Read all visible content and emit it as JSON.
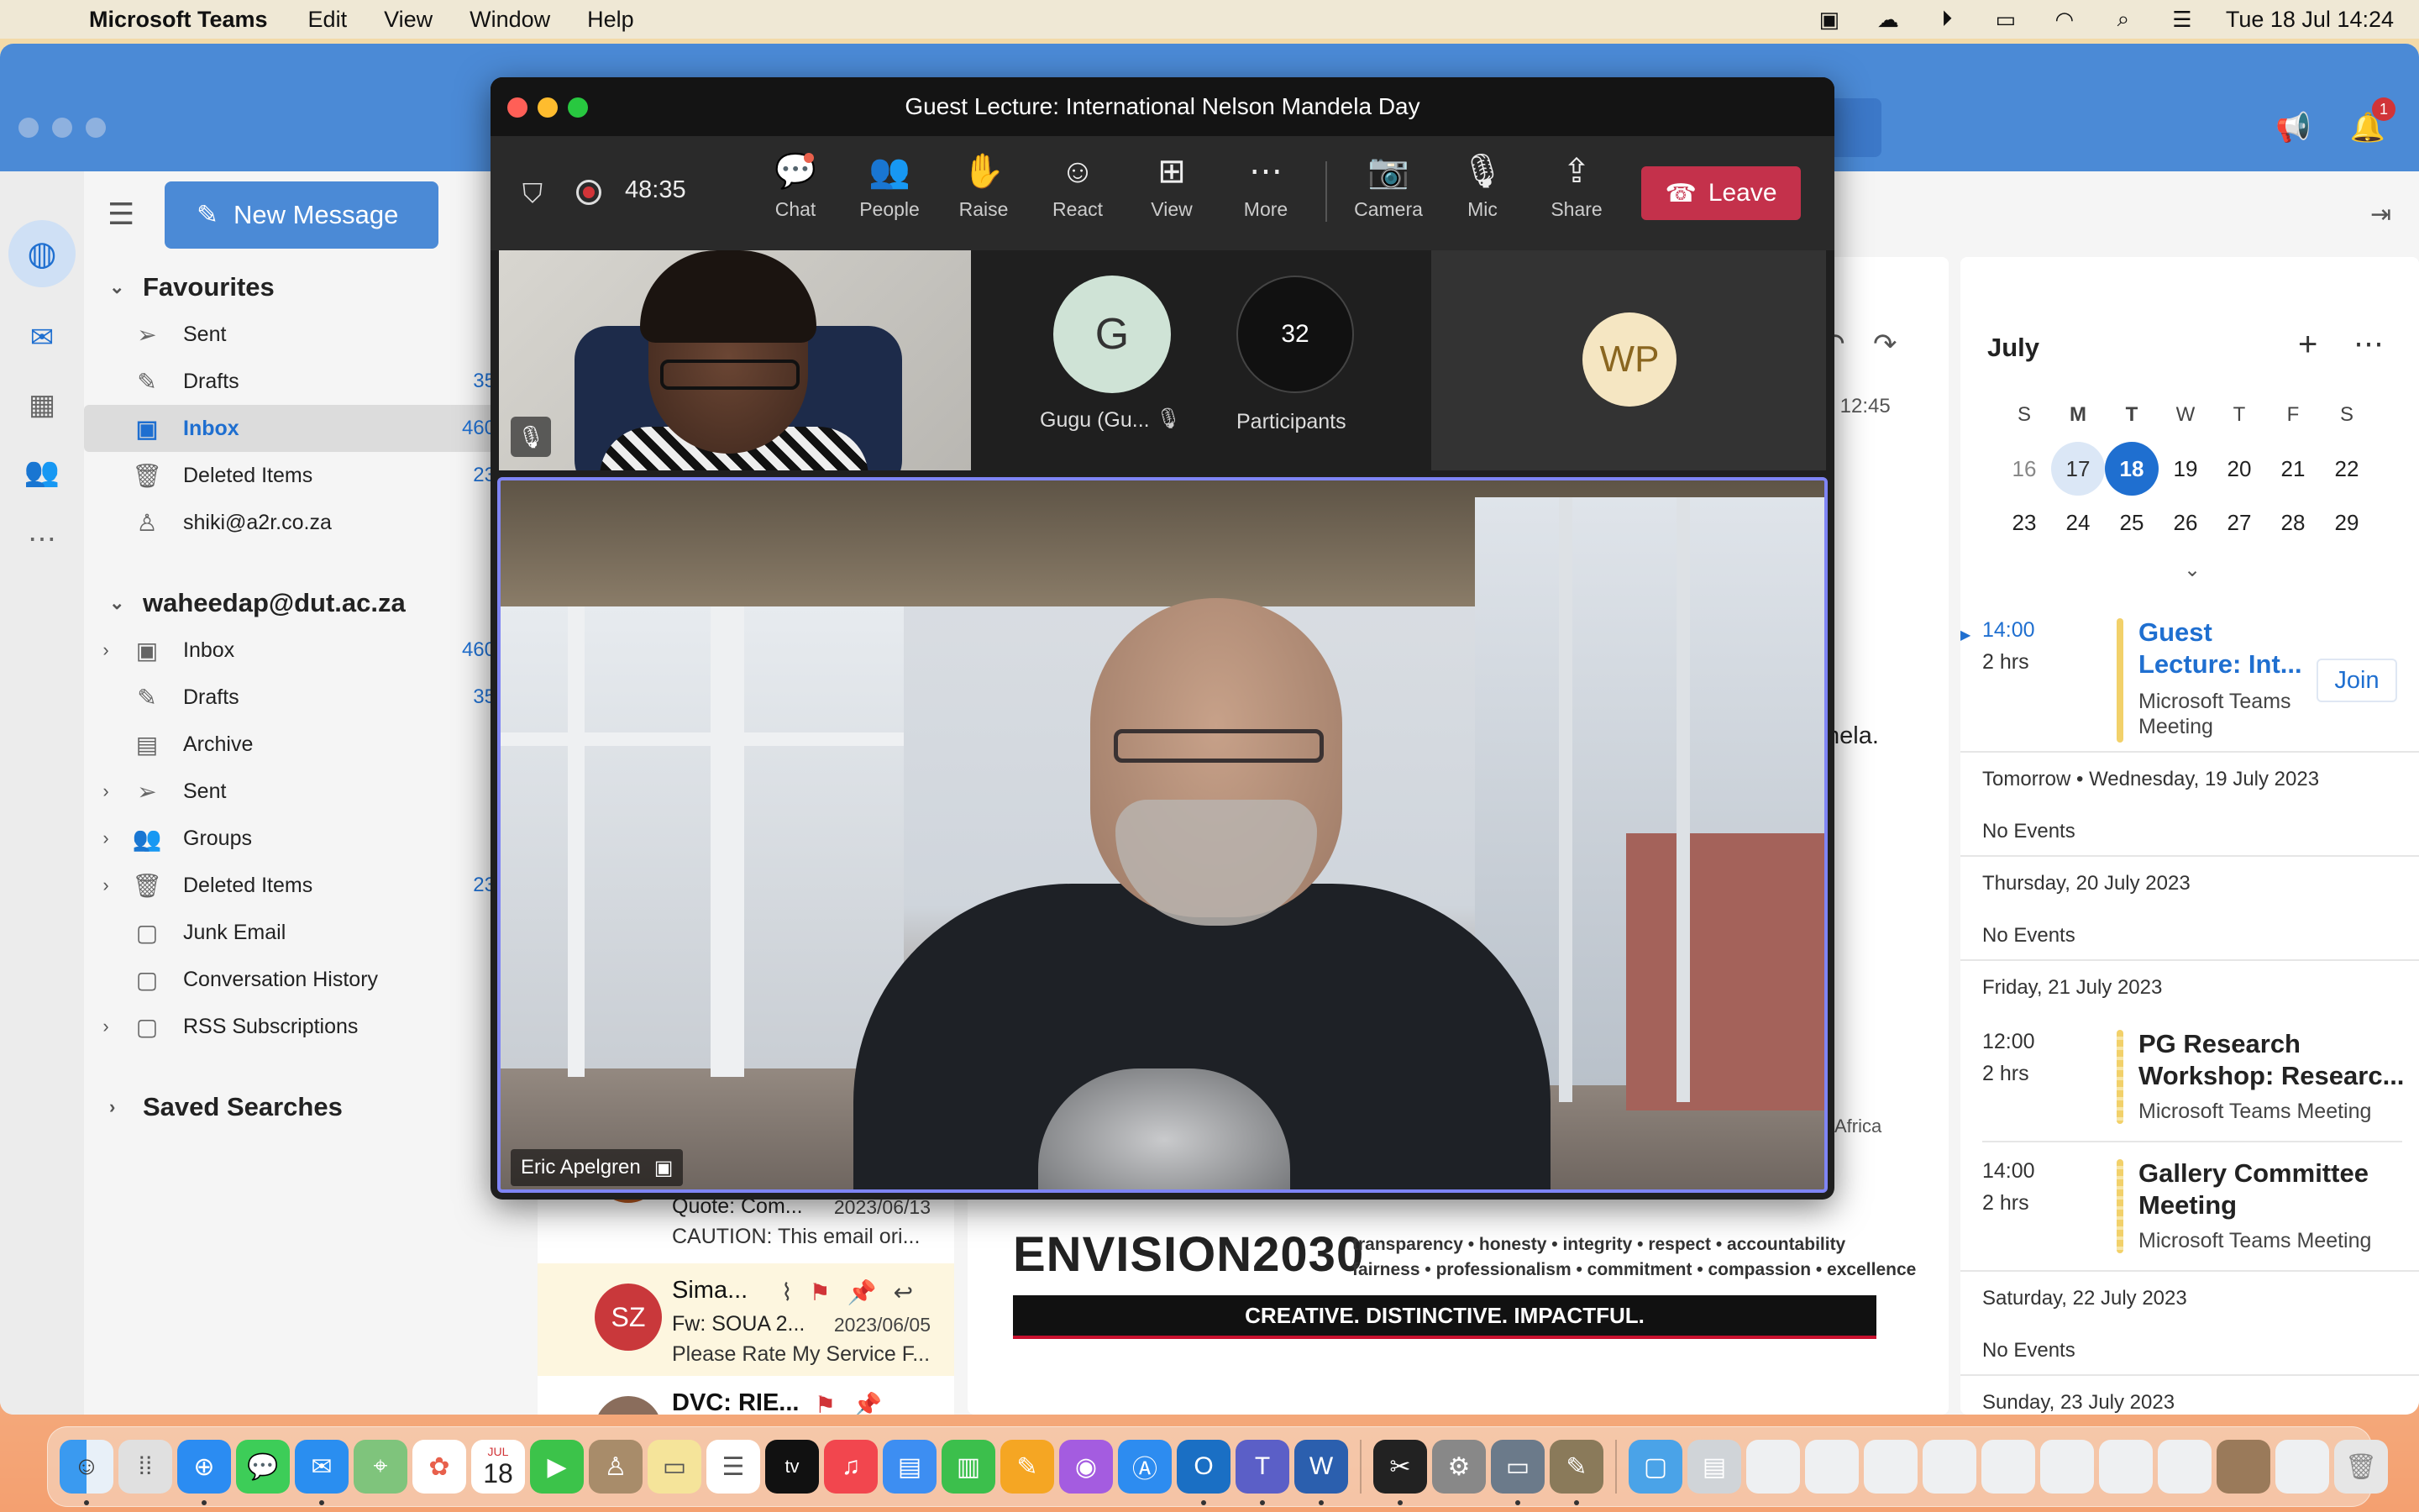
{
  "menubar": {
    "app_name": "Microsoft Teams",
    "menus": [
      "Edit",
      "View",
      "Window",
      "Help"
    ],
    "clock": "Tue 18 Jul  14:24"
  },
  "outlook": {
    "notification_count": "1",
    "new_message_label": "New Message",
    "favourites": {
      "title": "Favourites",
      "items": [
        {
          "label": "Sent",
          "count": ""
        },
        {
          "label": "Drafts",
          "count": "35"
        },
        {
          "label": "Inbox",
          "count": "460"
        },
        {
          "label": "Deleted Items",
          "count": "23"
        },
        {
          "label": "shiki@a2r.co.za",
          "count": ""
        }
      ]
    },
    "account": {
      "title": "waheedap@dut.ac.za",
      "items": [
        {
          "label": "Inbox",
          "count": "460"
        },
        {
          "label": "Drafts",
          "count": "35"
        },
        {
          "label": "Archive",
          "count": ""
        },
        {
          "label": "Sent",
          "count": ""
        },
        {
          "label": "Groups",
          "count": ""
        },
        {
          "label": "Deleted Items",
          "count": "23"
        },
        {
          "label": "Junk Email",
          "count": ""
        },
        {
          "label": "Conversation History",
          "count": ""
        },
        {
          "label": "RSS Subscriptions",
          "count": ""
        }
      ]
    },
    "saved_searches": "Saved Searches",
    "messages": [
      {
        "subject": "Quote: Com...",
        "date": "2023/06/13",
        "preview": "CAUTION: This email ori..."
      },
      {
        "initials": "SZ",
        "from": "Sima...",
        "subject": "Fw: SOUA 2...",
        "date": "2023/06/05",
        "preview": "Please Rate My Service F..."
      },
      {
        "from": "DVC: RIE..."
      }
    ],
    "reading_fragments": {
      "time": "at 12:45",
      "mandela": "nela.",
      "africa": "Africa"
    },
    "envision": {
      "logo": "ENVISION2030",
      "values_line1": "transparency • honesty • integrity • respect • accountability",
      "values_line2": "fairness • professionalism • commitment • compassion • excellence",
      "tagline": "CREATIVE. DISTINCTIVE. IMPACTFUL."
    }
  },
  "calendar": {
    "month": "July",
    "weekdays": [
      "S",
      "M",
      "T",
      "W",
      "T",
      "F",
      "S"
    ],
    "week1": [
      "16",
      "17",
      "18",
      "19",
      "20",
      "21",
      "22"
    ],
    "week2": [
      "23",
      "24",
      "25",
      "26",
      "27",
      "28",
      "29"
    ],
    "today_event": {
      "time": "14:00",
      "duration": "2 hrs",
      "title_line1": "Guest",
      "title_line2": "Lecture: Int...",
      "sub_line1": "Microsoft Teams",
      "sub_line2": "Meeting",
      "join_label": "Join"
    },
    "tomorrow_header": "Tomorrow • Wednesday, 19 July 2023",
    "no_events": "No Events",
    "thursday_header": "Thursday, 20 July 2023",
    "friday_header": "Friday, 21 July 2023",
    "friday_events": [
      {
        "time": "12:00",
        "duration": "2 hrs",
        "title_line1": "PG Research",
        "title_line2": "Workshop:  Researc...",
        "sub": "Microsoft Teams Meeting"
      },
      {
        "time": "14:00",
        "duration": "2 hrs",
        "title_line1": "Gallery Committee",
        "title_line2": "Meeting",
        "sub": "Microsoft Teams Meeting"
      }
    ],
    "saturday_header": "Saturday, 22 July 2023",
    "sunday_header": "Sunday, 23 July 2023"
  },
  "teams": {
    "window_title": "Guest Lecture: International Nelson Mandela Day",
    "timer": "48:35",
    "toolbar": [
      "Chat",
      "People",
      "Raise",
      "React",
      "View",
      "More",
      "Camera",
      "Mic",
      "Share"
    ],
    "leave_label": "Leave",
    "participant_g": {
      "initial": "G",
      "name": "Gugu (Gu..."
    },
    "participants_count": "32",
    "participants_label": "Participants",
    "participant_wp": "WP",
    "speaker_name": "Eric Apelgren"
  },
  "dock": {
    "calendar_month": "JUL",
    "calendar_day": "18",
    "tv_label": "tv"
  }
}
